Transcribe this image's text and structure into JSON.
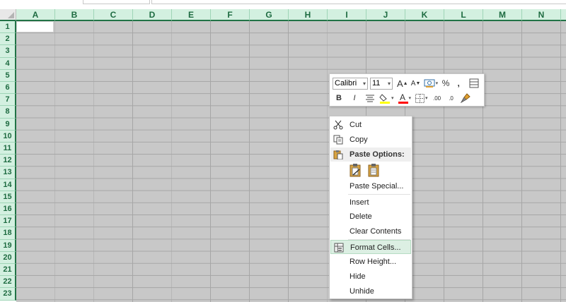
{
  "spreadsheet": {
    "columns": [
      "A",
      "B",
      "C",
      "D",
      "E",
      "F",
      "G",
      "H",
      "I",
      "J",
      "K",
      "L",
      "M",
      "N"
    ],
    "rows": [
      "1",
      "2",
      "3",
      "4",
      "5",
      "6",
      "7",
      "8",
      "9",
      "10",
      "11",
      "12",
      "13",
      "14",
      "15",
      "16",
      "17",
      "18",
      "19",
      "20",
      "21",
      "22",
      "23"
    ]
  },
  "mini_toolbar": {
    "font_name": "Calibri",
    "font_size": "11",
    "grow_font": "A",
    "shrink_font": "A",
    "percent": "%",
    "comma": ",",
    "bold": "B",
    "italic": "I",
    "font_color": "A",
    "decrease_decimal_label": ".00",
    "increase_decimal_label": ".0",
    "highlight_color": "#ffff00",
    "font_color_value": "#ff0000"
  },
  "context_menu": {
    "cut": "Cut",
    "copy": "Copy",
    "paste_options": "Paste Options:",
    "paste_special": "Paste Special...",
    "insert": "Insert",
    "delete": "Delete",
    "clear_contents": "Clear Contents",
    "format_cells": "Format Cells...",
    "row_height": "Row Height...",
    "hide": "Hide",
    "unhide": "Unhide"
  },
  "colors": {
    "header_bg": "#d3f0e0",
    "header_accent": "#217346",
    "selection_bg": "#c8c8c8",
    "menu_highlight": "#dcefe3"
  }
}
